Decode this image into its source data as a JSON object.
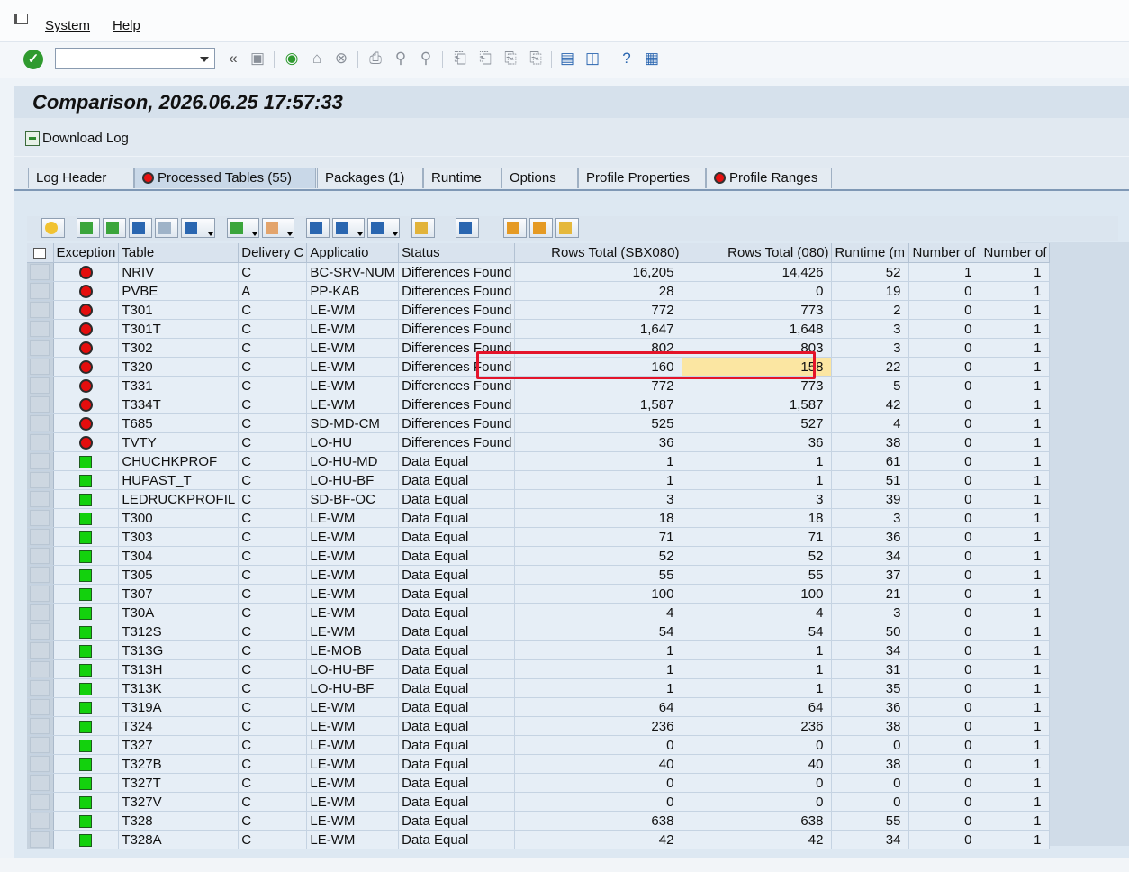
{
  "menu": {
    "system": "System",
    "help": "Help"
  },
  "toolbar": {
    "command_value": ""
  },
  "title": "Comparison, 2026.06.25 17:57:33",
  "app_toolbar": {
    "download_log": "Download Log"
  },
  "tabs": [
    {
      "label": "Log Header",
      "led": false
    },
    {
      "label": "Processed Tables (55)",
      "led": true
    },
    {
      "label": "Packages (1)",
      "led": false
    },
    {
      "label": "Runtime",
      "led": false
    },
    {
      "label": "Options",
      "led": false
    },
    {
      "label": "Profile Properties",
      "led": false
    },
    {
      "label": "Profile Ranges",
      "led": true
    }
  ],
  "grid": {
    "columns": [
      "Exception",
      "Table",
      "Delivery C",
      "Applicatio",
      "Status",
      "Rows Total (SBX080)",
      "Rows Total (080)",
      "Runtime (m",
      "Number of",
      "Number of"
    ],
    "rows": [
      {
        "exception": "red",
        "table": "NRIV",
        "delivery": "C",
        "app": "BC-SRV-NUM",
        "status": "Differences Found",
        "rows_sbx": "16,205",
        "rows_080": "14,426",
        "runtime": "52",
        "num1": "1",
        "num2": "1"
      },
      {
        "exception": "red",
        "table": "PVBE",
        "delivery": "A",
        "app": "PP-KAB",
        "status": "Differences Found",
        "rows_sbx": "28",
        "rows_080": "0",
        "runtime": "19",
        "num1": "0",
        "num2": "1"
      },
      {
        "exception": "red",
        "table": "T301",
        "delivery": "C",
        "app": "LE-WM",
        "status": "Differences Found",
        "rows_sbx": "772",
        "rows_080": "773",
        "runtime": "2",
        "num1": "0",
        "num2": "1"
      },
      {
        "exception": "red",
        "table": "T301T",
        "delivery": "C",
        "app": "LE-WM",
        "status": "Differences Found",
        "rows_sbx": "1,647",
        "rows_080": "1,648",
        "runtime": "3",
        "num1": "0",
        "num2": "1"
      },
      {
        "exception": "red",
        "table": "T302",
        "delivery": "C",
        "app": "LE-WM",
        "status": "Differences Found",
        "rows_sbx": "802",
        "rows_080": "803",
        "runtime": "3",
        "num1": "0",
        "num2": "1"
      },
      {
        "exception": "red",
        "table": "T320",
        "delivery": "C",
        "app": "LE-WM",
        "status": "Differences Found",
        "rows_sbx": "160",
        "rows_080": "158",
        "runtime": "22",
        "num1": "0",
        "num2": "1",
        "highlight": true
      },
      {
        "exception": "red",
        "table": "T331",
        "delivery": "C",
        "app": "LE-WM",
        "status": "Differences Found",
        "rows_sbx": "772",
        "rows_080": "773",
        "runtime": "5",
        "num1": "0",
        "num2": "1"
      },
      {
        "exception": "red",
        "table": "T334T",
        "delivery": "C",
        "app": "LE-WM",
        "status": "Differences Found",
        "rows_sbx": "1,587",
        "rows_080": "1,587",
        "runtime": "42",
        "num1": "0",
        "num2": "1"
      },
      {
        "exception": "red",
        "table": "T685",
        "delivery": "C",
        "app": "SD-MD-CM",
        "status": "Differences Found",
        "rows_sbx": "525",
        "rows_080": "527",
        "runtime": "4",
        "num1": "0",
        "num2": "1"
      },
      {
        "exception": "red",
        "table": "TVTY",
        "delivery": "C",
        "app": "LO-HU",
        "status": "Differences Found",
        "rows_sbx": "36",
        "rows_080": "36",
        "runtime": "38",
        "num1": "0",
        "num2": "1"
      },
      {
        "exception": "green",
        "table": "CHUCHKPROF",
        "delivery": "C",
        "app": "LO-HU-MD",
        "status": "Data Equal",
        "rows_sbx": "1",
        "rows_080": "1",
        "runtime": "61",
        "num1": "0",
        "num2": "1"
      },
      {
        "exception": "green",
        "table": "HUPAST_T",
        "delivery": "C",
        "app": "LO-HU-BF",
        "status": "Data Equal",
        "rows_sbx": "1",
        "rows_080": "1",
        "runtime": "51",
        "num1": "0",
        "num2": "1"
      },
      {
        "exception": "green",
        "table": "LEDRUCKPROFIL",
        "delivery": "C",
        "app": "SD-BF-OC",
        "status": "Data Equal",
        "rows_sbx": "3",
        "rows_080": "3",
        "runtime": "39",
        "num1": "0",
        "num2": "1"
      },
      {
        "exception": "green",
        "table": "T300",
        "delivery": "C",
        "app": "LE-WM",
        "status": "Data Equal",
        "rows_sbx": "18",
        "rows_080": "18",
        "runtime": "3",
        "num1": "0",
        "num2": "1"
      },
      {
        "exception": "green",
        "table": "T303",
        "delivery": "C",
        "app": "LE-WM",
        "status": "Data Equal",
        "rows_sbx": "71",
        "rows_080": "71",
        "runtime": "36",
        "num1": "0",
        "num2": "1"
      },
      {
        "exception": "green",
        "table": "T304",
        "delivery": "C",
        "app": "LE-WM",
        "status": "Data Equal",
        "rows_sbx": "52",
        "rows_080": "52",
        "runtime": "34",
        "num1": "0",
        "num2": "1"
      },
      {
        "exception": "green",
        "table": "T305",
        "delivery": "C",
        "app": "LE-WM",
        "status": "Data Equal",
        "rows_sbx": "55",
        "rows_080": "55",
        "runtime": "37",
        "num1": "0",
        "num2": "1"
      },
      {
        "exception": "green",
        "table": "T307",
        "delivery": "C",
        "app": "LE-WM",
        "status": "Data Equal",
        "rows_sbx": "100",
        "rows_080": "100",
        "runtime": "21",
        "num1": "0",
        "num2": "1"
      },
      {
        "exception": "green",
        "table": "T30A",
        "delivery": "C",
        "app": "LE-WM",
        "status": "Data Equal",
        "rows_sbx": "4",
        "rows_080": "4",
        "runtime": "3",
        "num1": "0",
        "num2": "1"
      },
      {
        "exception": "green",
        "table": "T312S",
        "delivery": "C",
        "app": "LE-WM",
        "status": "Data Equal",
        "rows_sbx": "54",
        "rows_080": "54",
        "runtime": "50",
        "num1": "0",
        "num2": "1"
      },
      {
        "exception": "green",
        "table": "T313G",
        "delivery": "C",
        "app": "LE-MOB",
        "status": "Data Equal",
        "rows_sbx": "1",
        "rows_080": "1",
        "runtime": "34",
        "num1": "0",
        "num2": "1"
      },
      {
        "exception": "green",
        "table": "T313H",
        "delivery": "C",
        "app": "LO-HU-BF",
        "status": "Data Equal",
        "rows_sbx": "1",
        "rows_080": "1",
        "runtime": "31",
        "num1": "0",
        "num2": "1"
      },
      {
        "exception": "green",
        "table": "T313K",
        "delivery": "C",
        "app": "LO-HU-BF",
        "status": "Data Equal",
        "rows_sbx": "1",
        "rows_080": "1",
        "runtime": "35",
        "num1": "0",
        "num2": "1"
      },
      {
        "exception": "green",
        "table": "T319A",
        "delivery": "C",
        "app": "LE-WM",
        "status": "Data Equal",
        "rows_sbx": "64",
        "rows_080": "64",
        "runtime": "36",
        "num1": "0",
        "num2": "1"
      },
      {
        "exception": "green",
        "table": "T324",
        "delivery": "C",
        "app": "LE-WM",
        "status": "Data Equal",
        "rows_sbx": "236",
        "rows_080": "236",
        "runtime": "38",
        "num1": "0",
        "num2": "1"
      },
      {
        "exception": "green",
        "table": "T327",
        "delivery": "C",
        "app": "LE-WM",
        "status": "Data Equal",
        "rows_sbx": "0",
        "rows_080": "0",
        "runtime": "0",
        "num1": "0",
        "num2": "1"
      },
      {
        "exception": "green",
        "table": "T327B",
        "delivery": "C",
        "app": "LE-WM",
        "status": "Data Equal",
        "rows_sbx": "40",
        "rows_080": "40",
        "runtime": "38",
        "num1": "0",
        "num2": "1"
      },
      {
        "exception": "green",
        "table": "T327T",
        "delivery": "C",
        "app": "LE-WM",
        "status": "Data Equal",
        "rows_sbx": "0",
        "rows_080": "0",
        "runtime": "0",
        "num1": "0",
        "num2": "1"
      },
      {
        "exception": "green",
        "table": "T327V",
        "delivery": "C",
        "app": "LE-WM",
        "status": "Data Equal",
        "rows_sbx": "0",
        "rows_080": "0",
        "runtime": "0",
        "num1": "0",
        "num2": "1"
      },
      {
        "exception": "green",
        "table": "T328",
        "delivery": "C",
        "app": "LE-WM",
        "status": "Data Equal",
        "rows_sbx": "638",
        "rows_080": "638",
        "runtime": "55",
        "num1": "0",
        "num2": "1"
      },
      {
        "exception": "green",
        "table": "T328A",
        "delivery": "C",
        "app": "LE-WM",
        "status": "Data Equal",
        "rows_sbx": "42",
        "rows_080": "42",
        "runtime": "34",
        "num1": "0",
        "num2": "1"
      }
    ]
  },
  "colors": {
    "led_red": "#e40d0d",
    "led_green": "#13d10d",
    "highlight": "#fbe6a2",
    "callout": "#e4142a"
  }
}
